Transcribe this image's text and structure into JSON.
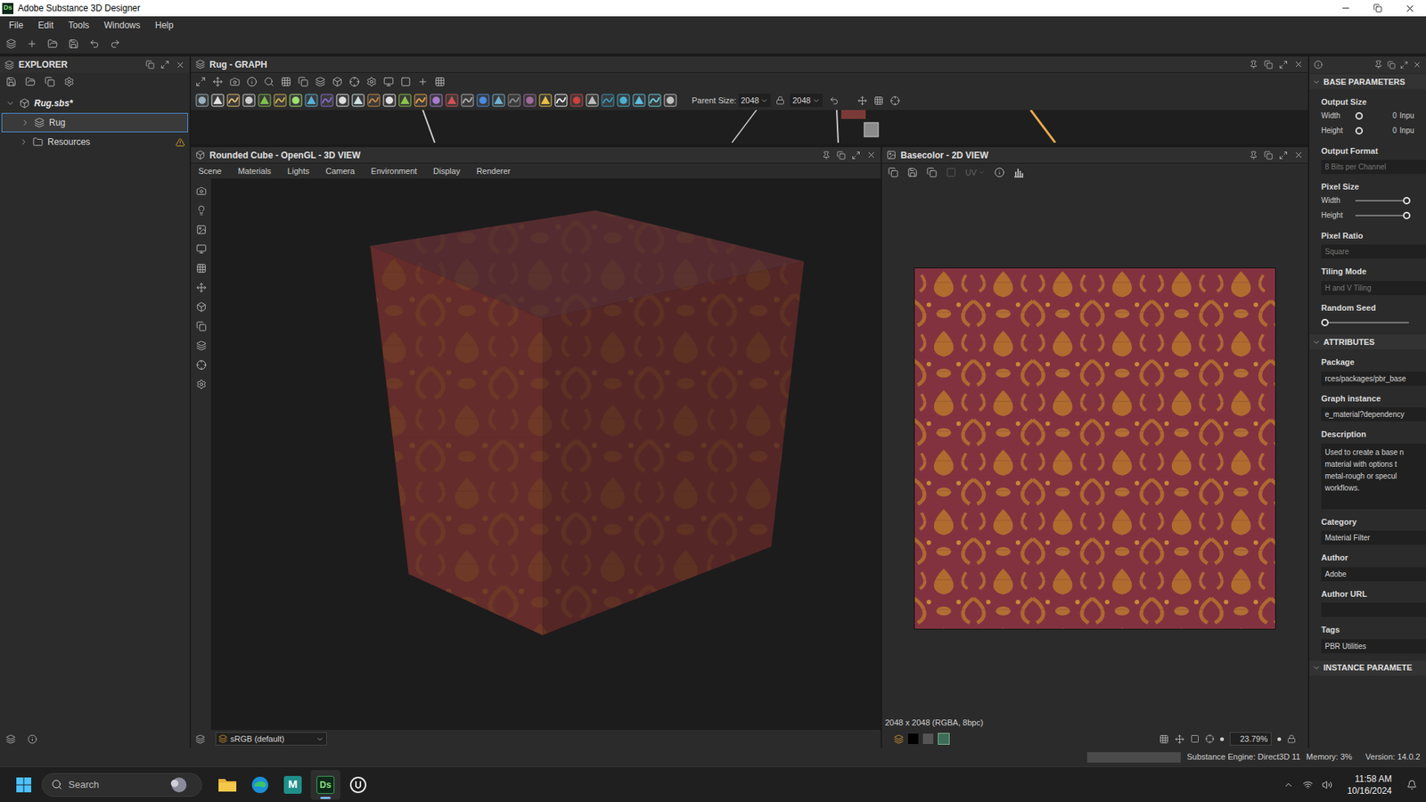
{
  "window": {
    "title": "Adobe Substance 3D Designer",
    "badge": "Ds"
  },
  "menu": [
    "File",
    "Edit",
    "Tools",
    "Windows",
    "Help"
  ],
  "explorer": {
    "title": "EXPLORER",
    "tree": [
      {
        "label": "Rug.sbs*",
        "kind": "package",
        "expanded": true,
        "selected": false,
        "warning": false
      },
      {
        "label": "Rug",
        "kind": "graph",
        "expanded": false,
        "selected": true,
        "warning": false
      },
      {
        "label": "Resources",
        "kind": "folder",
        "expanded": false,
        "selected": false,
        "warning": true
      }
    ]
  },
  "graph": {
    "title": "Rug - GRAPH",
    "parent_size_label": "Parent Size:",
    "parent_size": "2048",
    "output_size": "2048"
  },
  "view3d": {
    "title": "Rounded Cube - OpenGL - 3D VIEW",
    "menu": [
      "Scene",
      "Materials",
      "Lights",
      "Camera",
      "Environment",
      "Display",
      "Renderer"
    ],
    "color_space": "sRGB (default)"
  },
  "view2d": {
    "title": "Basecolor - 2D VIEW",
    "uv_label": "UV",
    "uv_disabled": true,
    "info": "2048 x 2048 (RGBA, 8bpc)",
    "zoom": "23.79%"
  },
  "properties": {
    "sections": [
      {
        "title": "BASE PARAMETERS",
        "expanded": true,
        "groups": [
          {
            "label": "Output Size",
            "kind": "radio-rows",
            "rows": [
              {
                "label": "Width",
                "value": "0",
                "mode": "Inpu"
              },
              {
                "label": "Height",
                "value": "0",
                "mode": "Inpu"
              }
            ]
          },
          {
            "label": "Output Format",
            "kind": "field",
            "value": "8 Bits per Channel",
            "disabled": true
          },
          {
            "label": "Pixel Size",
            "kind": "slider-rows",
            "rows": [
              {
                "label": "Width",
                "level": 1
              },
              {
                "label": "Height",
                "level": 1
              }
            ]
          },
          {
            "label": "Pixel Ratio",
            "kind": "field",
            "value": "Square",
            "disabled": true
          },
          {
            "label": "Tiling Mode",
            "kind": "field",
            "value": "H and V Tiling",
            "disabled": true
          },
          {
            "label": "Random Seed",
            "kind": "slider",
            "level": 0
          }
        ]
      },
      {
        "title": "ATTRIBUTES",
        "expanded": true,
        "groups": [
          {
            "label": "Package",
            "kind": "field",
            "value": "rces/packages/pbr_base",
            "disabled": false
          },
          {
            "label": "Graph instance",
            "kind": "field",
            "value": "e_material?dependency",
            "disabled": false
          },
          {
            "label": "Description",
            "kind": "textarea",
            "lines": [
              "Used to create a base n",
              "material with options t",
              "metal-rough or specul",
              "workflows."
            ]
          },
          {
            "label": "Category",
            "kind": "field",
            "value": "Material Filter",
            "disabled": false
          },
          {
            "label": "Author",
            "kind": "field",
            "value": "Adobe",
            "disabled": false
          },
          {
            "label": "Author URL",
            "kind": "field",
            "value": "",
            "disabled": false
          },
          {
            "label": "Tags",
            "kind": "field",
            "value": "PBR Utilities",
            "disabled": false
          }
        ]
      },
      {
        "title": "INSTANCE PARAMETE",
        "expanded": true,
        "groups": []
      }
    ]
  },
  "status_bar": {
    "engine": "Substance Engine: Direct3D 11",
    "memory": "Memory: 3%",
    "version": "Version: 14.0.2"
  },
  "taskbar": {
    "search_placeholder": "Search",
    "apps": [
      {
        "kind": "folder",
        "active": false
      },
      {
        "kind": "edge",
        "active": false
      },
      {
        "kind": "maya",
        "label": "M",
        "active": false
      },
      {
        "kind": "substance",
        "label": "Ds",
        "active": true
      },
      {
        "kind": "unreal",
        "active": false
      }
    ],
    "time": "11:58 AM",
    "date": "10/16/2024"
  }
}
